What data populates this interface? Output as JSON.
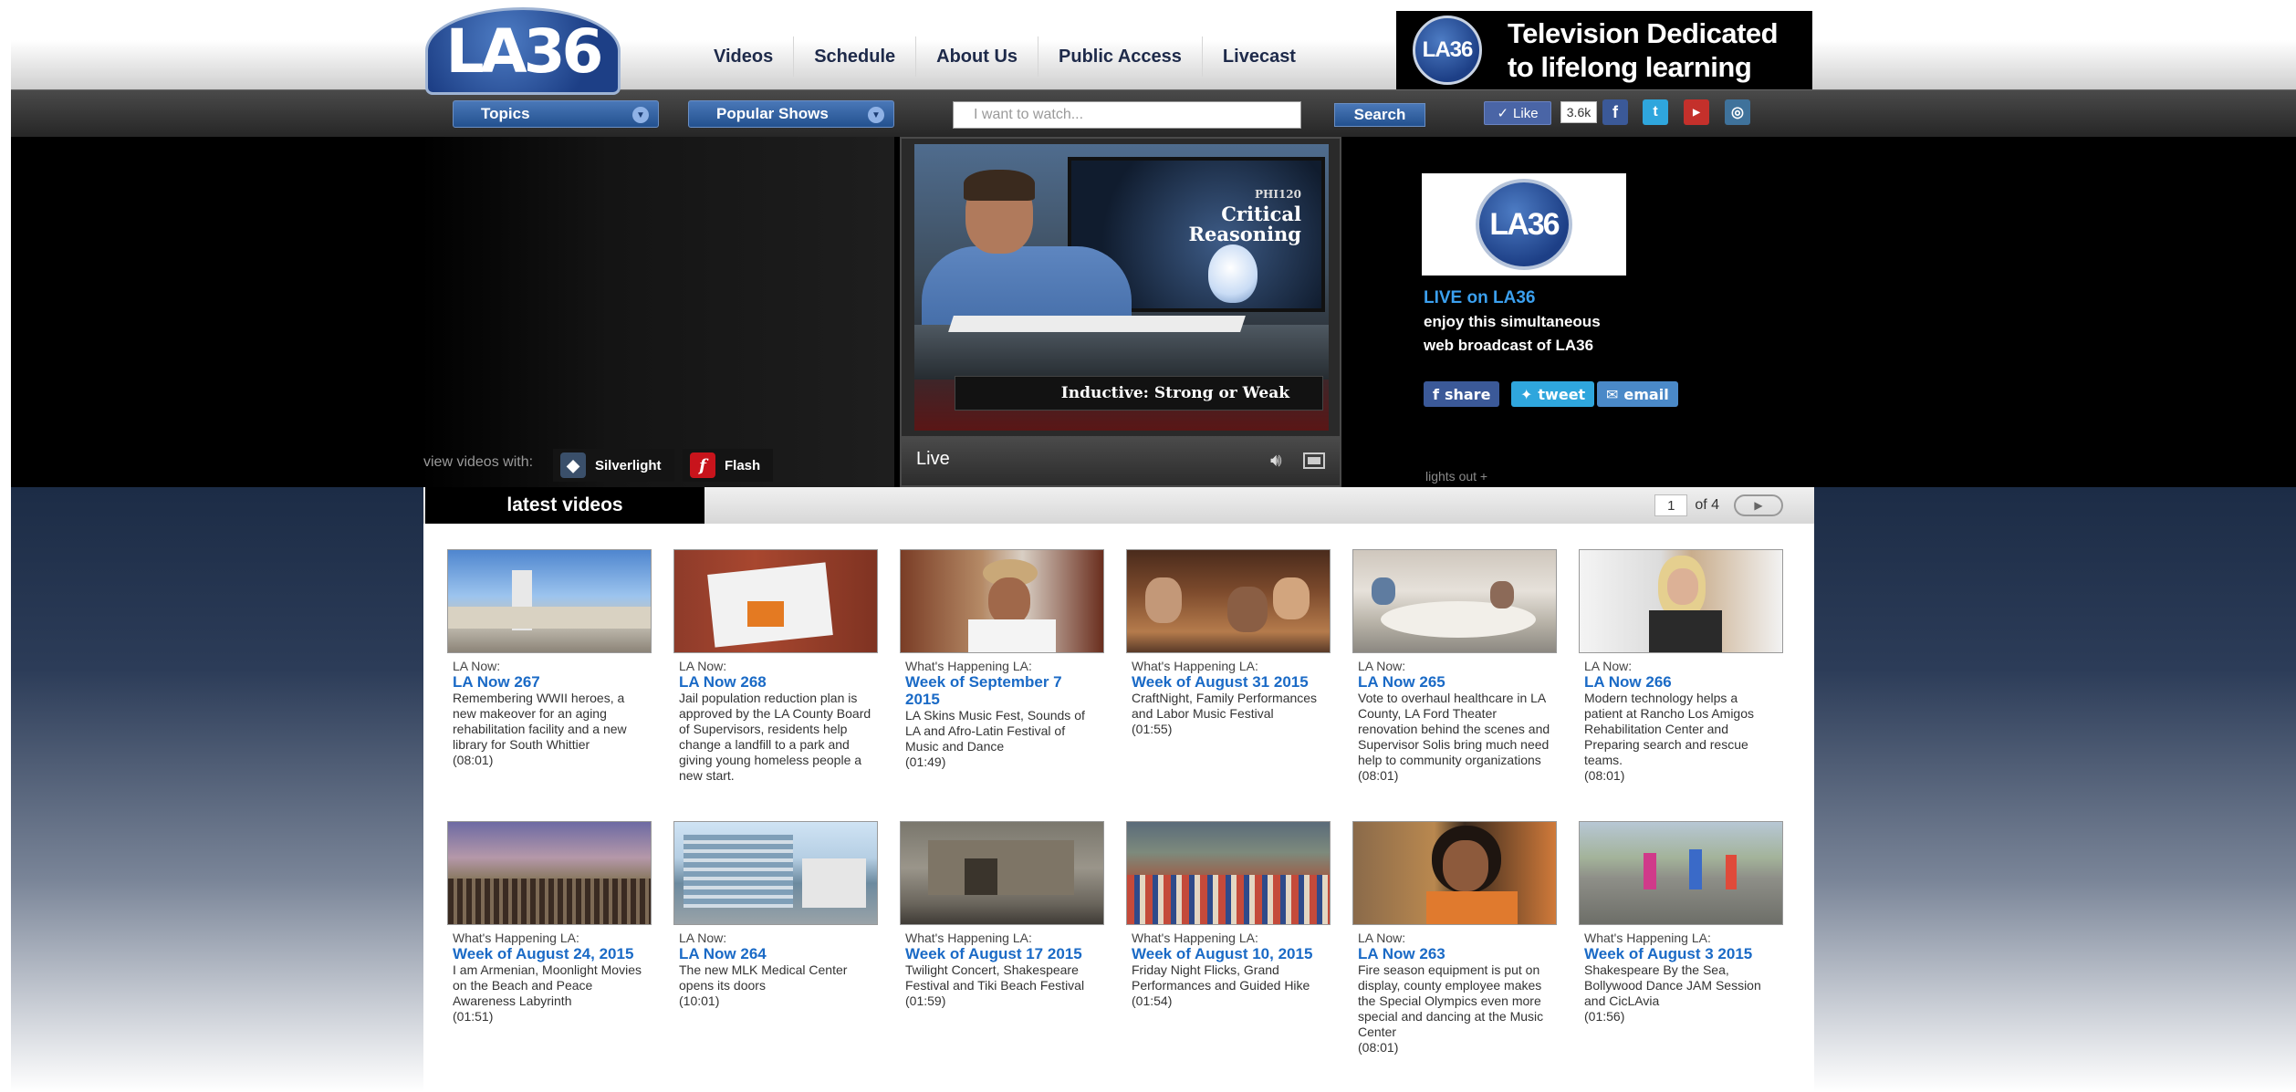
{
  "header": {
    "logo_text": "LA36",
    "nav": [
      "Videos",
      "Schedule",
      "About Us",
      "Public Access",
      "Livecast"
    ],
    "banner": {
      "logo_text": "LA36",
      "line1": "Television Dedicated",
      "line2": "to lifelong learning"
    }
  },
  "toolbar": {
    "topics_label": "Topics",
    "popular_shows_label": "Popular Shows",
    "search_placeholder": "I want to watch...",
    "search_button": "Search",
    "like_label": "Like",
    "like_count": "3.6k",
    "social_icons": [
      "facebook-icon",
      "twitter-icon",
      "youtube-icon",
      "instagram-icon"
    ]
  },
  "player": {
    "view_with_label": "view videos with:",
    "silverlight_label": "Silverlight",
    "flash_label": "Flash",
    "slide_code": "PHI120",
    "slide_title_line1": "Critical",
    "slide_title_line2": "Reasoning",
    "lower_third": "Inductive: Strong or Weak",
    "status": "Live"
  },
  "live_panel": {
    "logo_text": "LA36",
    "title": "LIVE on LA36",
    "desc_line1": "enjoy this simultaneous",
    "desc_line2": "web broadcast of LA36",
    "share_label": "share",
    "tweet_label": "tweet",
    "email_label": "email",
    "lights_out": "lights out +"
  },
  "latest": {
    "tab_label": "latest videos",
    "page_current": "1",
    "page_of": "of 4",
    "videos": [
      {
        "category": "LA Now:",
        "title": "LA Now 267",
        "desc": "Remembering WWII heroes, a new makeover for an aging rehabilitation facility and a new library for South Whittier",
        "duration": "(08:01)"
      },
      {
        "category": "LA Now:",
        "title": "LA Now 268",
        "desc": "Jail population reduction plan is approved by the LA County Board of Supervisors, residents help change a landfill to a park and giving young homeless people a new start.",
        "duration": ""
      },
      {
        "category": "What's Happening LA:",
        "title": "Week of September 7 2015",
        "desc": " LA Skins Music Fest, Sounds of LA and Afro-Latin Festival of Music and Dance",
        "duration": "(01:49)"
      },
      {
        "category": "What's Happening LA:",
        "title": "Week of August 31 2015",
        "desc": "CraftNight, Family Performances and Labor Music Festival",
        "duration": "(01:55)"
      },
      {
        "category": "LA Now:",
        "title": "LA Now 265",
        "desc": "Vote to overhaul healthcare in LA County, LA Ford Theater renovation behind the scenes and Supervisor Solis bring much need help to community organizations",
        "duration": "(08:01)"
      },
      {
        "category": "LA Now:",
        "title": "LA Now 266",
        "desc": "Modern technology helps a patient at Rancho Los Amigos Rehabilitation Center and Preparing search and rescue teams.",
        "duration": "(08:01)"
      },
      {
        "category": "What's Happening LA:",
        "title": "Week of August 24, 2015",
        "desc": "I am Armenian, Moonlight Movies on the Beach and Peace Awareness Labyrinth",
        "duration": "(01:51)"
      },
      {
        "category": "LA Now:",
        "title": "LA Now 264",
        "desc": "The new MLK Medical Center opens its doors",
        "duration": "(10:01)"
      },
      {
        "category": "What's Happening LA:",
        "title": "Week of August 17 2015",
        "desc": "Twilight Concert, Shakespeare Festival and Tiki Beach Festival",
        "duration": "(01:59)"
      },
      {
        "category": "What's Happening LA:",
        "title": "Week of August 10, 2015",
        "desc": "Friday Night Flicks, Grand Performances and Guided Hike",
        "duration": "(01:54)"
      },
      {
        "category": "LA Now:",
        "title": "LA Now 263",
        "desc": "Fire season equipment is put on display, county employee makes the Special Olympics even more special and dancing at the Music Center",
        "duration": "(08:01)"
      },
      {
        "category": "What's Happening LA:",
        "title": "Week of August 3 2015",
        "desc": "Shakespeare By the Sea, Bollywood Dance JAM Session and CicLAvia",
        "duration": "(01:56)"
      }
    ]
  }
}
